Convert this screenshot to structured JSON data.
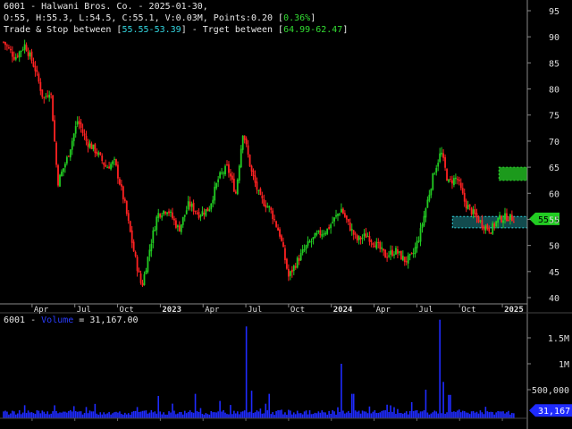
{
  "header": {
    "line1": "6001 - Halwani Bros. Co. - 2025-01-30,",
    "line2_prefix": "O:55, H:55.3, L:54.5, C:55.1, V:0.03M, Points:0.20 [",
    "line2_pct": "0.36%",
    "line2_suffix": "]",
    "line3_a": "Trade & Stop between [",
    "line3_trade": "55.55-53.39",
    "line3_b": "] - Trget between [",
    "line3_target": "64.99-62.47",
    "line3_c": "]"
  },
  "volume_header": {
    "prefix": "6001 - ",
    "name": "Volume",
    "suffix": " = 31,167.00"
  },
  "colors": {
    "background": "#000000",
    "up": "#22cc22",
    "down": "#ff2222",
    "volume": "#1f2bff",
    "trade_zone": "#33d6e0",
    "target_zone": "#1c9a1c",
    "grid": "#555555"
  },
  "chart_data": [
    {
      "type": "candlestick",
      "symbol": "6001",
      "ylim": [
        38,
        96
      ],
      "y_ticks": [
        40,
        45,
        50,
        55,
        60,
        65,
        70,
        75,
        80,
        85,
        90,
        95
      ],
      "x_ticks": [
        "Apr",
        "Jul",
        "Oct",
        "2023",
        "Apr",
        "Jul",
        "Oct",
        "2024",
        "Apr",
        "Jul",
        "Oct",
        "2025"
      ],
      "x_tick_pos": [
        2,
        5,
        8,
        11,
        14,
        17,
        20,
        23,
        26,
        29,
        32,
        35
      ],
      "months_span": 37,
      "last_close_label": "55.1",
      "last_close": 55.1,
      "trade_zone": [
        53.39,
        55.55
      ],
      "target_zone": [
        62.47,
        64.99
      ],
      "zone_start_month": 31.5,
      "close_path": [
        {
          "m": 0,
          "v": 89
        },
        {
          "m": 0.8,
          "v": 86
        },
        {
          "m": 1.5,
          "v": 88.5
        },
        {
          "m": 2.2,
          "v": 84
        },
        {
          "m": 2.8,
          "v": 78
        },
        {
          "m": 3.3,
          "v": 80
        },
        {
          "m": 3.8,
          "v": 62
        },
        {
          "m": 4.5,
          "v": 67
        },
        {
          "m": 5.2,
          "v": 74
        },
        {
          "m": 5.8,
          "v": 70
        },
        {
          "m": 6.5,
          "v": 68
        },
        {
          "m": 7.2,
          "v": 65
        },
        {
          "m": 7.8,
          "v": 66
        },
        {
          "m": 8.5,
          "v": 58
        },
        {
          "m": 9.2,
          "v": 48
        },
        {
          "m": 9.7,
          "v": 42
        },
        {
          "m": 10.3,
          "v": 50
        },
        {
          "m": 10.8,
          "v": 56
        },
        {
          "m": 11.5,
          "v": 57
        },
        {
          "m": 12.3,
          "v": 53
        },
        {
          "m": 13,
          "v": 58
        },
        {
          "m": 13.7,
          "v": 56
        },
        {
          "m": 14.4,
          "v": 57
        },
        {
          "m": 15.1,
          "v": 63
        },
        {
          "m": 15.7,
          "v": 65
        },
        {
          "m": 16.3,
          "v": 60
        },
        {
          "m": 16.8,
          "v": 72
        },
        {
          "m": 17.4,
          "v": 64
        },
        {
          "m": 18,
          "v": 59
        },
        {
          "m": 18.7,
          "v": 57
        },
        {
          "m": 19.4,
          "v": 52
        },
        {
          "m": 20,
          "v": 44
        },
        {
          "m": 20.6,
          "v": 47
        },
        {
          "m": 21.3,
          "v": 50
        },
        {
          "m": 22,
          "v": 52
        },
        {
          "m": 22.7,
          "v": 53
        },
        {
          "m": 23.2,
          "v": 55
        },
        {
          "m": 23.7,
          "v": 57
        },
        {
          "m": 24.2,
          "v": 54
        },
        {
          "m": 24.8,
          "v": 51
        },
        {
          "m": 25.5,
          "v": 52
        },
        {
          "m": 26.2,
          "v": 50
        },
        {
          "m": 26.8,
          "v": 48
        },
        {
          "m": 27.5,
          "v": 49
        },
        {
          "m": 28.2,
          "v": 47
        },
        {
          "m": 28.7,
          "v": 48
        },
        {
          "m": 29.2,
          "v": 52
        },
        {
          "m": 29.7,
          "v": 58
        },
        {
          "m": 30.2,
          "v": 64
        },
        {
          "m": 30.7,
          "v": 68
        },
        {
          "m": 31.2,
          "v": 62
        },
        {
          "m": 31.8,
          "v": 63
        },
        {
          "m": 32.4,
          "v": 58
        },
        {
          "m": 33,
          "v": 56
        },
        {
          "m": 33.6,
          "v": 54
        },
        {
          "m": 34.2,
          "v": 53
        },
        {
          "m": 34.7,
          "v": 55
        },
        {
          "m": 35.3,
          "v": 55.5
        },
        {
          "m": 35.8,
          "v": 55.1
        }
      ]
    },
    {
      "type": "bar",
      "series_name": "Volume",
      "ylim": [
        0,
        1900000
      ],
      "y_ticks": [
        500000,
        1000000,
        1500000
      ],
      "y_tick_labels": [
        "500,000",
        "1M",
        "1.5M"
      ],
      "last_value": 31167,
      "last_value_label": "31,167",
      "spikes": [
        {
          "m": 10.9,
          "v": 380000
        },
        {
          "m": 13.5,
          "v": 420000
        },
        {
          "m": 17.0,
          "v": 1720000
        },
        {
          "m": 17.4,
          "v": 480000
        },
        {
          "m": 18.6,
          "v": 420000
        },
        {
          "m": 23.7,
          "v": 1000000
        },
        {
          "m": 24.5,
          "v": 420000
        },
        {
          "m": 29.6,
          "v": 500000
        },
        {
          "m": 30.6,
          "v": 1850000
        },
        {
          "m": 30.9,
          "v": 650000
        },
        {
          "m": 31.3,
          "v": 400000
        }
      ]
    }
  ]
}
